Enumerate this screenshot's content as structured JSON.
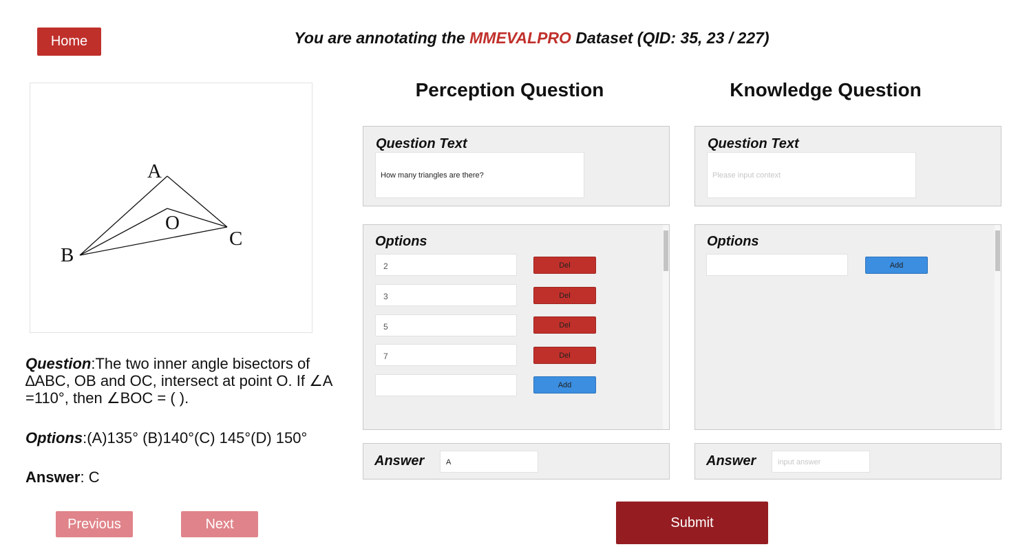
{
  "nav": {
    "home_label": "Home",
    "previous_label": "Previous",
    "next_label": "Next",
    "submit_label": "Submit"
  },
  "header": {
    "prefix": "You are annotating the ",
    "dataset": "MMEVALPRO",
    "suffix": " Dataset (QID: 35, 23 / 227)"
  },
  "figure": {
    "labels": [
      "A",
      "O",
      "B",
      "C"
    ]
  },
  "question": {
    "question_label": "Question",
    "question_text": ":The two inner angle bisectors of ∆ABC, OB and OC, intersect at point O. If ∠A =110°, then ∠BOC = ( ).",
    "options_label": "Options",
    "options_text": ":(A)135° (B)140°(C) 145°(D) 150°",
    "answer_label": "Answer",
    "answer_text": ": C"
  },
  "perception": {
    "title": "Perception Question",
    "question_text_label": "Question Text",
    "question_text_value": "How many triangles are there?",
    "options_label": "Options",
    "options": [
      "2",
      "3",
      "5",
      "7"
    ],
    "del_label": "Del",
    "add_label": "Add",
    "answer_label": "Answer",
    "answer_value": "A"
  },
  "knowledge": {
    "title": "Knowledge Question",
    "question_text_label": "Question Text",
    "question_text_placeholder": "Please input context",
    "options_label": "Options",
    "add_label": "Add",
    "answer_label": "Answer",
    "answer_placeholder": "input answer"
  },
  "colors": {
    "accent_red": "#c0302b",
    "submit_red": "#951d22",
    "add_blue": "#3b8ee0",
    "nav_pink": "#e0838a"
  }
}
